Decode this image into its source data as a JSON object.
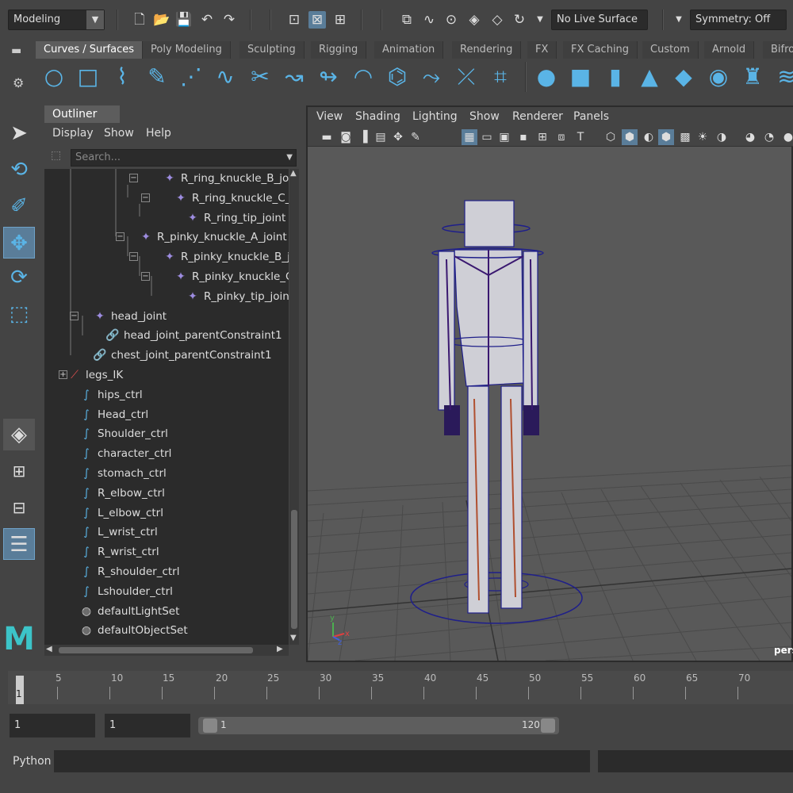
{
  "topbar": {
    "mode": "Modeling",
    "live_surface": "No Live Surface",
    "symmetry": "Symmetry: Off"
  },
  "shelf": {
    "tabs": [
      "Curves / Surfaces",
      "Poly Modeling",
      "Sculpting",
      "Rigging",
      "Animation",
      "Rendering",
      "FX",
      "FX Caching",
      "Custom",
      "Arnold",
      "Bifro"
    ],
    "active_tab": 0
  },
  "outliner": {
    "tab": "Outliner",
    "menu": [
      "Display",
      "Show",
      "Help"
    ],
    "search_placeholder": "Search...",
    "rows": [
      {
        "label": "R_ring_knuckle_B_joint",
        "icon": "joint"
      },
      {
        "label": "R_ring_knuckle_C_joi",
        "icon": "joint"
      },
      {
        "label": "R_ring_tip_joint",
        "icon": "joint"
      },
      {
        "label": "R_pinky_knuckle_A_joint",
        "icon": "joint"
      },
      {
        "label": "R_pinky_knuckle_B_join",
        "icon": "joint"
      },
      {
        "label": "R_pinky_knuckle_C_jo",
        "icon": "joint"
      },
      {
        "label": "R_pinky_tip_joint",
        "icon": "joint"
      },
      {
        "label": "head_joint",
        "icon": "joint"
      },
      {
        "label": "head_joint_parentConstraint1",
        "icon": "constraint"
      },
      {
        "label": "chest_joint_parentConstraint1",
        "icon": "constraint"
      },
      {
        "label": "legs_IK",
        "icon": "ik"
      },
      {
        "label": "hips_ctrl",
        "icon": "curve"
      },
      {
        "label": "Head_ctrl",
        "icon": "curve"
      },
      {
        "label": "Shoulder_ctrl",
        "icon": "curve"
      },
      {
        "label": "character_ctrl",
        "icon": "curve"
      },
      {
        "label": "stomach_ctrl",
        "icon": "curve"
      },
      {
        "label": "R_elbow_ctrl",
        "icon": "curve"
      },
      {
        "label": "L_elbow_ctrl",
        "icon": "curve"
      },
      {
        "label": "L_wrist_ctrl",
        "icon": "curve"
      },
      {
        "label": "R_wrist_ctrl",
        "icon": "curve"
      },
      {
        "label": "R_shoulder_ctrl",
        "icon": "curve"
      },
      {
        "label": "Lshoulder_ctrl",
        "icon": "curve"
      },
      {
        "label": "defaultLightSet",
        "icon": "set"
      },
      {
        "label": "defaultObjectSet",
        "icon": "set"
      }
    ]
  },
  "viewport": {
    "menu": [
      "View",
      "Shading",
      "Lighting",
      "Show",
      "Renderer",
      "Panels"
    ],
    "camera_label": "pers",
    "axis_labels": {
      "x": "x",
      "y": "y",
      "z": "z"
    }
  },
  "timeline": {
    "current_frame": "1",
    "ticks": [
      "5",
      "10",
      "15",
      "20",
      "25",
      "30",
      "35",
      "40",
      "45",
      "50",
      "55",
      "60",
      "65",
      "70"
    ]
  },
  "range": {
    "start": "1",
    "playback_start": "1",
    "slider_start": "1",
    "slider_end": "120"
  },
  "command_line": {
    "language": "Python"
  },
  "colors": {
    "accent": "#5ab4e6",
    "joint": "#9d8ce0",
    "constraint": "#e05050",
    "highlight": "#5a7d99"
  }
}
